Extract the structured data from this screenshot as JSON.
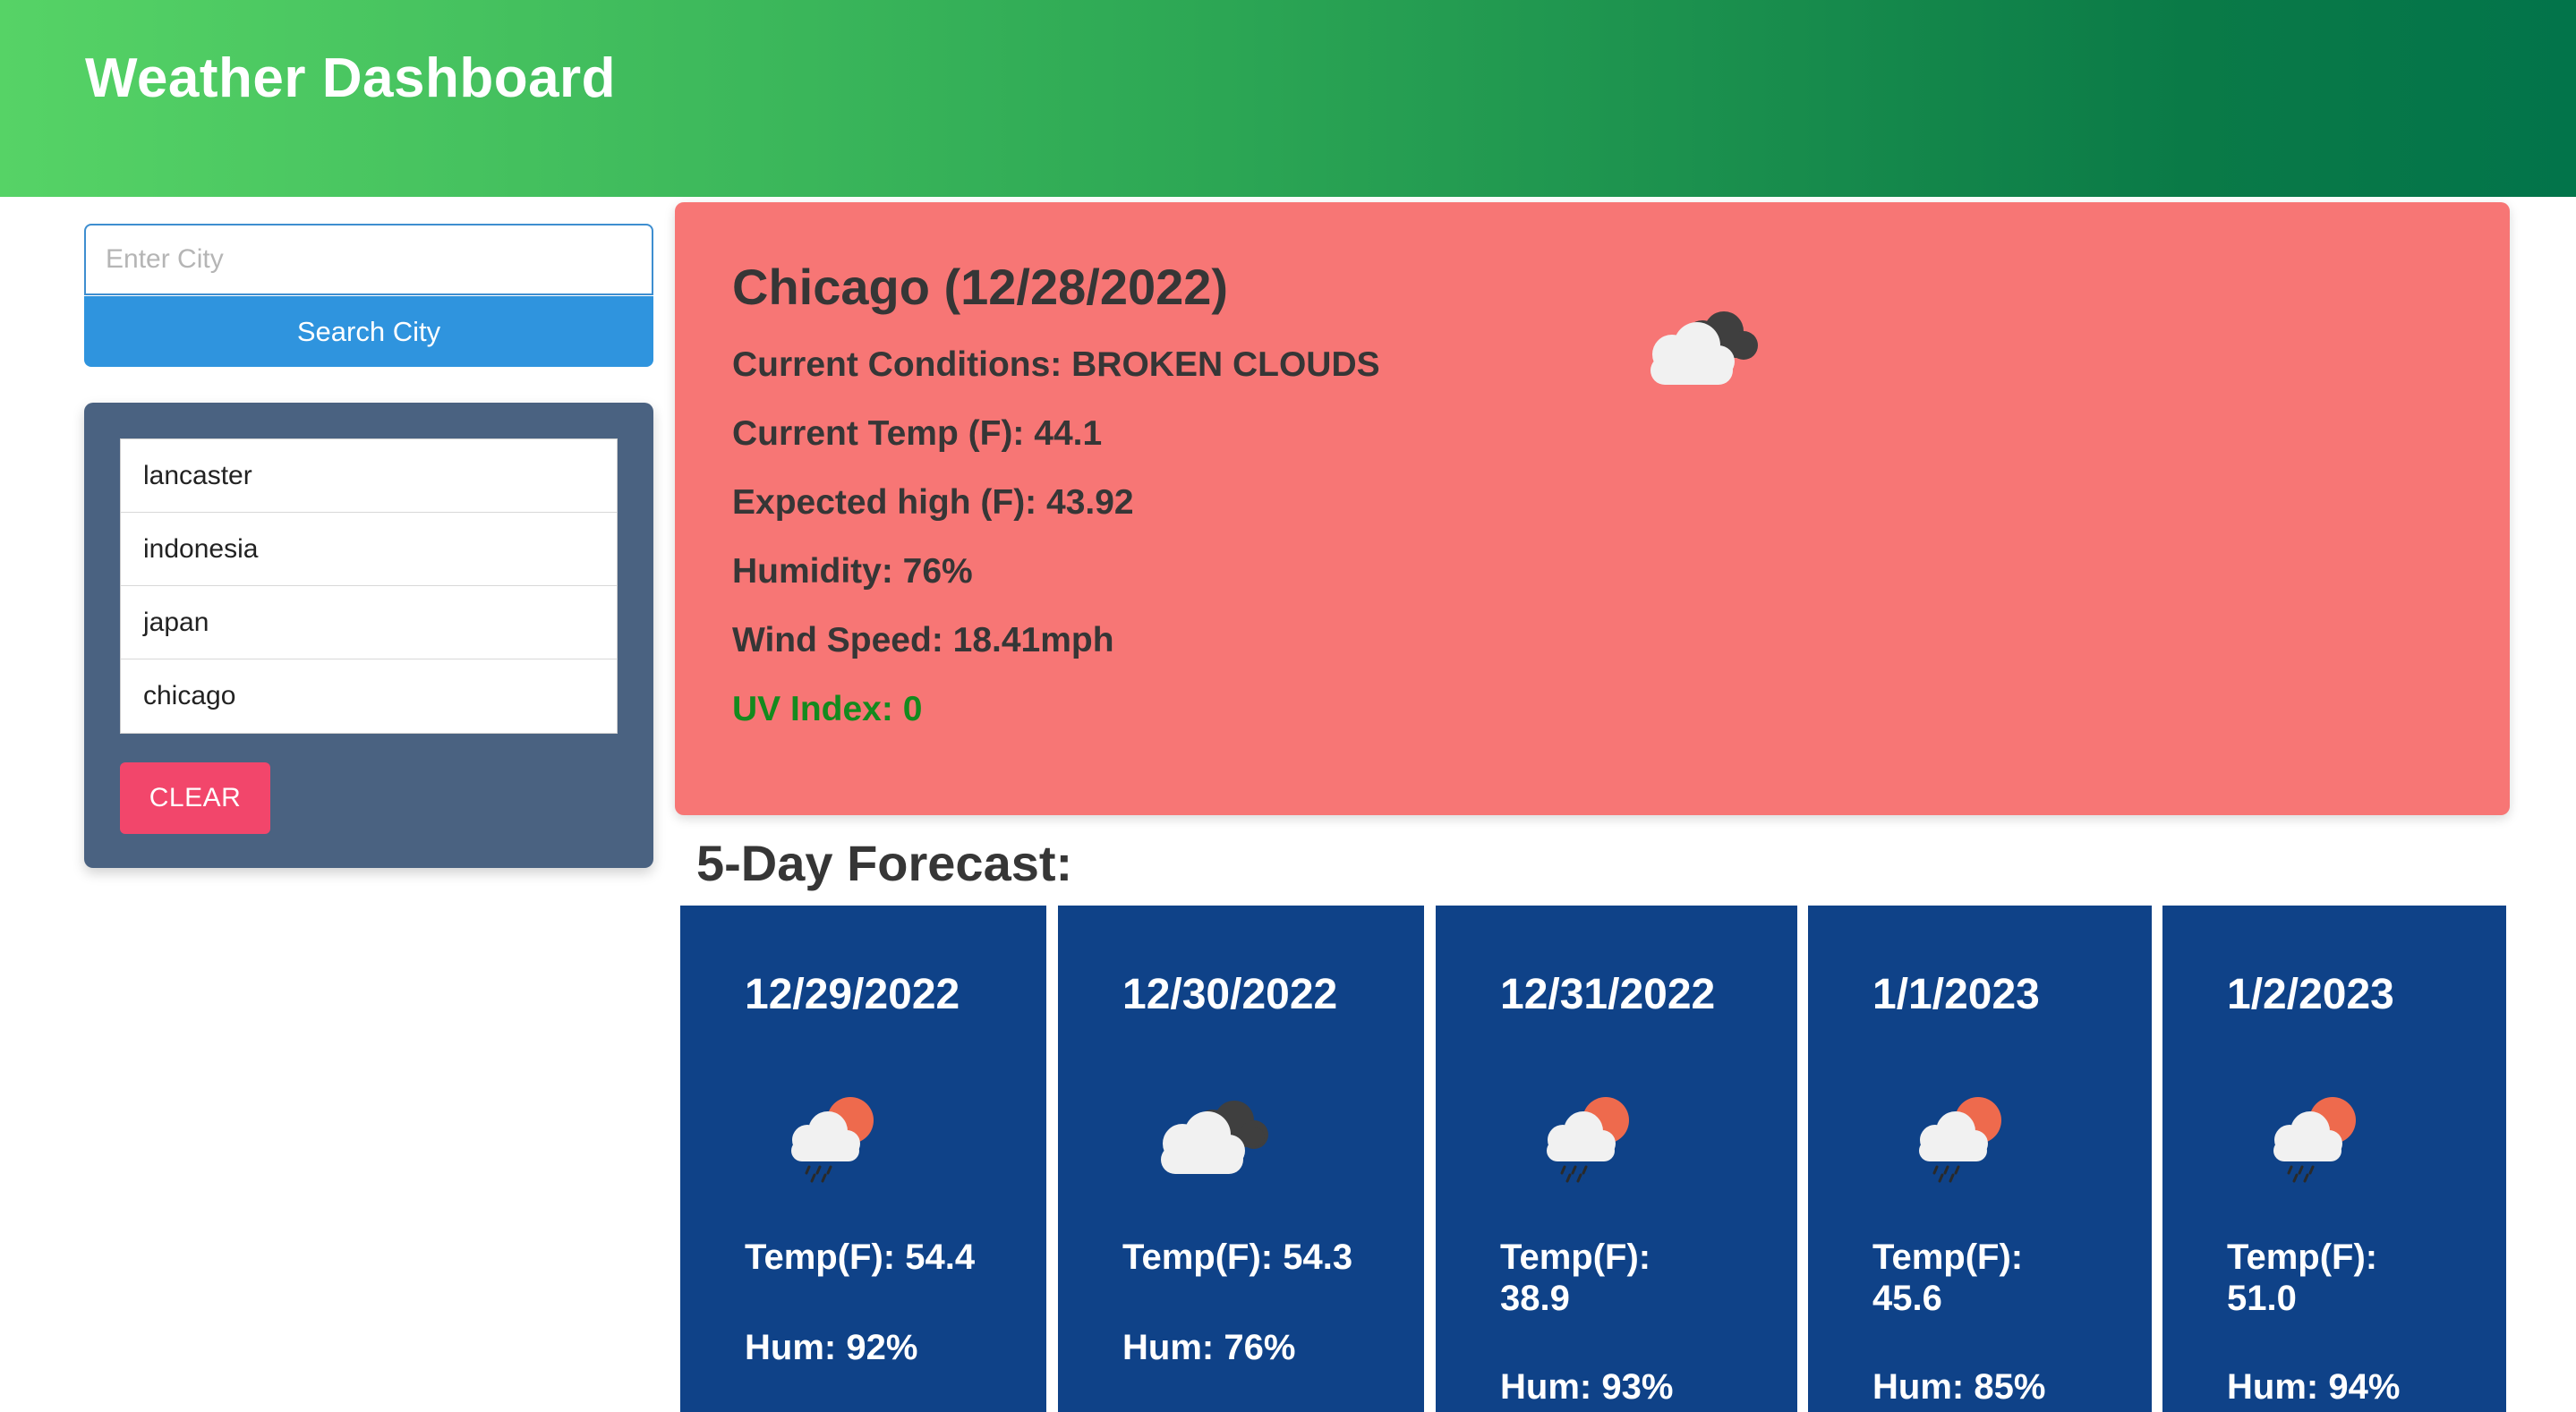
{
  "header": {
    "title": "Weather Dashboard"
  },
  "search": {
    "placeholder": "Enter City",
    "button_label": "Search City"
  },
  "history": {
    "items": [
      "lancaster",
      "indonesia",
      "japan",
      "chicago"
    ],
    "clear_label": "CLEAR"
  },
  "current": {
    "title": "Chicago (12/28/2022)",
    "conditions": "Current Conditions: BROKEN CLOUDS",
    "temp": "Current Temp (F): 44.1",
    "high": "Expected high (F): 43.92",
    "humidity": "Humidity: 76%",
    "wind": "Wind Speed: 18.41mph",
    "uv": "UV Index: 0",
    "icon": "broken-clouds-icon"
  },
  "forecast": {
    "heading": "5-Day Forecast:",
    "days": [
      {
        "date": "12/29/2022",
        "temp": "Temp(F): 54.4",
        "hum": "Hum: 92%",
        "icon": "rain-sun-icon"
      },
      {
        "date": "12/30/2022",
        "temp": "Temp(F): 54.3",
        "hum": "Hum: 76%",
        "icon": "broken-clouds-icon"
      },
      {
        "date": "12/31/2022",
        "temp": "Temp(F): 38.9",
        "hum": "Hum: 93%",
        "icon": "rain-sun-icon"
      },
      {
        "date": "1/1/2023",
        "temp": "Temp(F): 45.6",
        "hum": "Hum: 85%",
        "icon": "rain-sun-icon"
      },
      {
        "date": "1/2/2023",
        "temp": "Temp(F): 51.0",
        "hum": "Hum: 94%",
        "icon": "rain-sun-icon"
      }
    ]
  },
  "colors": {
    "header_start": "#56d366",
    "header_end": "#02744a",
    "search_button": "#2f94de",
    "history_panel": "#4a6281",
    "clear_button": "#f2466b",
    "current_card": "#f77675",
    "uv_index": "#148a1e",
    "forecast_card": "#0f4288"
  }
}
